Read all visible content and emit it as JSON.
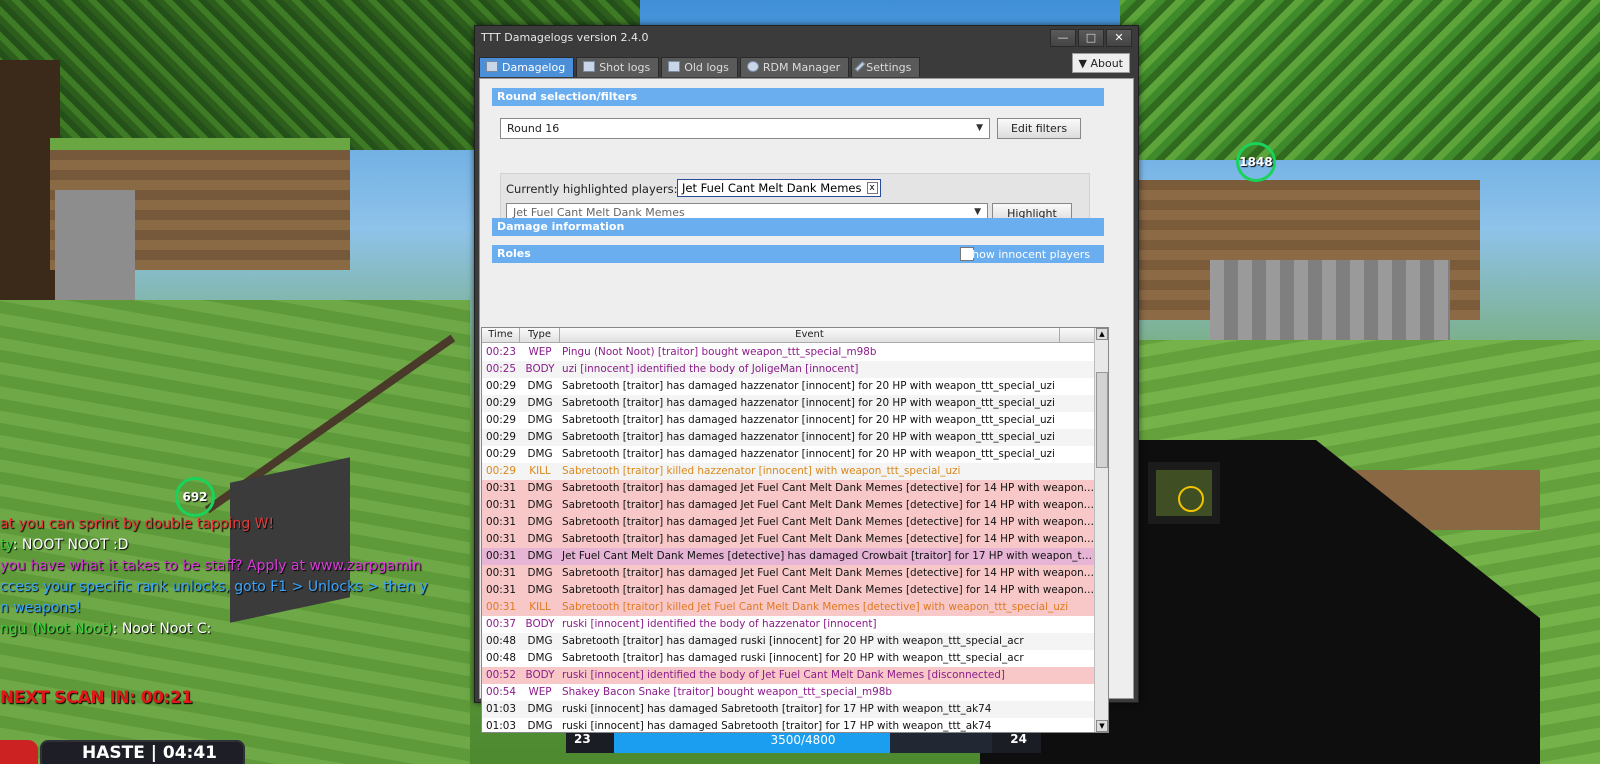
{
  "hud": {
    "ring_left": "692",
    "ring_right": "1848",
    "chat": [
      {
        "parts": [
          {
            "t": "at you can sprint by double tapping W!",
            "c": "#e23a3a"
          }
        ]
      },
      {
        "parts": [
          {
            "t": "ty",
            "c": "#3bd43b"
          },
          {
            "t": ": NOOT NOOT :D",
            "c": "#ffffff"
          }
        ]
      },
      {
        "parts": [
          {
            "t": "you have what it takes to be staff? Apply at www.zarpgamin",
            "c": "#d93ad9"
          }
        ]
      },
      {
        "parts": [
          {
            "t": "ccess your specific rank unlocks, goto F1 > Unlocks > then y",
            "c": "#39a7ff"
          }
        ]
      },
      {
        "parts": [
          {
            "t": "n weapons!",
            "c": "#39a7ff"
          }
        ]
      },
      {
        "parts": [
          {
            "t": "ngu (Noot Noot)",
            "c": "#3bd43b"
          },
          {
            "t": ": Noot Noot C:",
            "c": "#ffffff"
          }
        ]
      }
    ],
    "scan_text": "NEXT SCAN IN: 00:21",
    "haste_text": "HASTE | 04:41",
    "ammo_left": "23",
    "ammo_text": "3500/4800",
    "ammo_fill": 0.73,
    "ammo_right": "24"
  },
  "window": {
    "title": "TTT Damagelogs  version 2.4.0",
    "buttons": {
      "minimize": "—",
      "maximize": "□",
      "close": "✕"
    },
    "about_label": "About",
    "tabs": [
      {
        "label": "Damagelog",
        "icon": "table-icon"
      },
      {
        "label": "Shot logs",
        "icon": "document-icon"
      },
      {
        "label": "Old logs",
        "icon": "calendar-icon"
      },
      {
        "label": "RDM Manager",
        "icon": "magnifier-icon"
      },
      {
        "label": "Settings",
        "icon": "wrench-icon"
      }
    ],
    "round_section": "Round selection/filters",
    "round_value": "Round 16",
    "edit_filters": "Edit filters",
    "highlighted_label": "Currently highlighted players:",
    "highlighted_chip": "Jet Fuel Cant Melt Dank Memes",
    "chip_close": "x",
    "player_select": "Jet Fuel Cant Melt Dank Memes",
    "highlight_btn": "Highlight",
    "damage_info": "Damage information",
    "roles": "Roles",
    "show_innocent": "Show innocent players",
    "log_headers": [
      "Time",
      "Type",
      "Event"
    ]
  },
  "log_rows": [
    {
      "time": "00:23",
      "type": "WEP",
      "event": "Pingu (Noot Noot) [traitor] bought weapon_ttt_special_m98b",
      "color": "#8a1c8a",
      "bg": ""
    },
    {
      "time": "00:25",
      "type": "BODY",
      "event": "uzi [innocent] identified the body of JoligeMan [innocent]",
      "color": "#8a1c8a",
      "bg": ""
    },
    {
      "time": "00:29",
      "type": "DMG",
      "event": "Sabretooth [traitor] has damaged hazzenator [innocent] for 20 HP with weapon_ttt_special_uzi",
      "color": "#111111",
      "bg": ""
    },
    {
      "time": "00:29",
      "type": "DMG",
      "event": "Sabretooth [traitor] has damaged hazzenator [innocent] for 20 HP with weapon_ttt_special_uzi",
      "color": "#111111",
      "bg": ""
    },
    {
      "time": "00:29",
      "type": "DMG",
      "event": "Sabretooth [traitor] has damaged hazzenator [innocent] for 20 HP with weapon_ttt_special_uzi",
      "color": "#111111",
      "bg": ""
    },
    {
      "time": "00:29",
      "type": "DMG",
      "event": "Sabretooth [traitor] has damaged hazzenator [innocent] for 20 HP with weapon_ttt_special_uzi",
      "color": "#111111",
      "bg": ""
    },
    {
      "time": "00:29",
      "type": "DMG",
      "event": "Sabretooth [traitor] has damaged hazzenator [innocent] for 20 HP with weapon_ttt_special_uzi",
      "color": "#111111",
      "bg": ""
    },
    {
      "time": "00:29",
      "type": "KILL",
      "event": "Sabretooth [traitor] killed hazzenator [innocent] with weapon_ttt_special_uzi",
      "color": "#d9891a",
      "bg": ""
    },
    {
      "time": "00:31",
      "type": "DMG",
      "event": "Sabretooth [traitor] has damaged Jet Fuel Cant Melt Dank Memes [detective] for 14 HP with weapon_...",
      "color": "#111111",
      "bg": "#f8c8c8"
    },
    {
      "time": "00:31",
      "type": "DMG",
      "event": "Sabretooth [traitor] has damaged Jet Fuel Cant Melt Dank Memes [detective] for 14 HP with weapon_...",
      "color": "#111111",
      "bg": "#f8c8c8"
    },
    {
      "time": "00:31",
      "type": "DMG",
      "event": "Sabretooth [traitor] has damaged Jet Fuel Cant Melt Dank Memes [detective] for 14 HP with weapon_...",
      "color": "#111111",
      "bg": "#f8c8c8"
    },
    {
      "time": "00:31",
      "type": "DMG",
      "event": "Sabretooth [traitor] has damaged Jet Fuel Cant Melt Dank Memes [detective] for 14 HP with weapon_...",
      "color": "#111111",
      "bg": "#f8c8c8"
    },
    {
      "time": "00:31",
      "type": "DMG",
      "event": "Jet Fuel Cant Melt Dank Memes [detective] has damaged Crowbait [traitor] for 17 HP with weapon_ttt...",
      "color": "#111111",
      "bg": "#e6b4d4"
    },
    {
      "time": "00:31",
      "type": "DMG",
      "event": "Sabretooth [traitor] has damaged Jet Fuel Cant Melt Dank Memes [detective] for 14 HP with weapon_...",
      "color": "#111111",
      "bg": "#f8c8c8"
    },
    {
      "time": "00:31",
      "type": "DMG",
      "event": "Sabretooth [traitor] has damaged Jet Fuel Cant Melt Dank Memes [detective] for 14 HP with weapon_...",
      "color": "#111111",
      "bg": "#f8c8c8"
    },
    {
      "time": "00:31",
      "type": "KILL",
      "event": "Sabretooth [traitor] killed Jet Fuel Cant Melt Dank Memes [detective] with weapon_ttt_special_uzi",
      "color": "#e07820",
      "bg": "#f8c8c8"
    },
    {
      "time": "00:37",
      "type": "BODY",
      "event": "ruski [innocent] identified the body of hazzenator [innocent]",
      "color": "#8a1c8a",
      "bg": ""
    },
    {
      "time": "00:48",
      "type": "DMG",
      "event": "Sabretooth [traitor] has damaged ruski [innocent] for 20 HP with weapon_ttt_special_acr",
      "color": "#111111",
      "bg": ""
    },
    {
      "time": "00:48",
      "type": "DMG",
      "event": "Sabretooth [traitor] has damaged ruski [innocent] for 20 HP with weapon_ttt_special_acr",
      "color": "#111111",
      "bg": ""
    },
    {
      "time": "00:52",
      "type": "BODY",
      "event": "ruski [innocent] identified the body of Jet Fuel Cant Melt Dank Memes [disconnected]",
      "color": "#8a1c8a",
      "bg": "#f8c8c8"
    },
    {
      "time": "00:54",
      "type": "WEP",
      "event": "Shakey Bacon Snake [traitor] bought weapon_ttt_special_m98b",
      "color": "#8a1c8a",
      "bg": ""
    },
    {
      "time": "01:03",
      "type": "DMG",
      "event": "ruski [innocent] has damaged Sabretooth [traitor] for 17 HP with weapon_ttt_ak74",
      "color": "#111111",
      "bg": ""
    },
    {
      "time": "01:03",
      "type": "DMG",
      "event": "ruski [innocent] has damaged Sabretooth [traitor] for 17 HP with weapon_ttt_ak74",
      "color": "#111111",
      "bg": ""
    }
  ]
}
